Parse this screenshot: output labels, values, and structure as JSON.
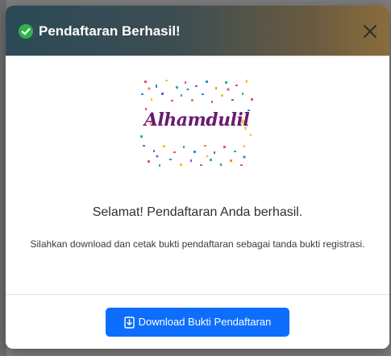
{
  "modal": {
    "title": "Pendaftaran Berhasil!",
    "title_icon": "check-circle-icon",
    "close_icon": "close-icon",
    "celebration_text": "Alhamdulil",
    "success_message": "Selamat! Pendaftaran Anda berhasil.",
    "instruction": "Silahkan download dan cetak bukti pendaftaran sebagai tanda bukti registrasi.",
    "download_button": {
      "label": "Download Bukti Pendaftaran",
      "icon": "download-file-icon"
    }
  },
  "colors": {
    "success_green": "#2fb34a",
    "primary_blue": "#0d6efd",
    "celebration_purple": "#6a1a6e",
    "header_dark": "#2b4a56",
    "header_warm": "#8a6c3c"
  }
}
